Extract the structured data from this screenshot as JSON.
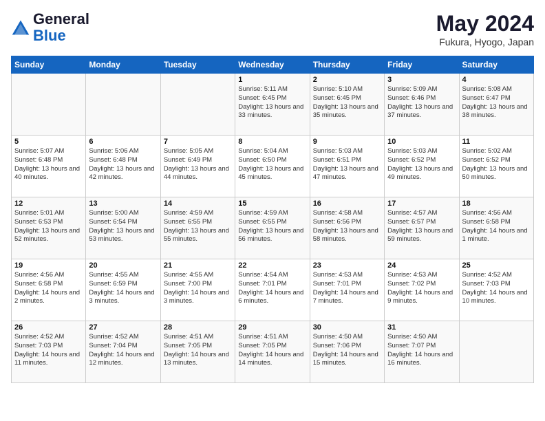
{
  "header": {
    "logo_general": "General",
    "logo_blue": "Blue",
    "month_title": "May 2024",
    "location": "Fukura, Hyogo, Japan"
  },
  "days_of_week": [
    "Sunday",
    "Monday",
    "Tuesday",
    "Wednesday",
    "Thursday",
    "Friday",
    "Saturday"
  ],
  "weeks": [
    [
      {
        "day": "",
        "content": ""
      },
      {
        "day": "",
        "content": ""
      },
      {
        "day": "",
        "content": ""
      },
      {
        "day": "1",
        "content": "Sunrise: 5:11 AM\nSunset: 6:45 PM\nDaylight: 13 hours and 33 minutes."
      },
      {
        "day": "2",
        "content": "Sunrise: 5:10 AM\nSunset: 6:45 PM\nDaylight: 13 hours and 35 minutes."
      },
      {
        "day": "3",
        "content": "Sunrise: 5:09 AM\nSunset: 6:46 PM\nDaylight: 13 hours and 37 minutes."
      },
      {
        "day": "4",
        "content": "Sunrise: 5:08 AM\nSunset: 6:47 PM\nDaylight: 13 hours and 38 minutes."
      }
    ],
    [
      {
        "day": "5",
        "content": "Sunrise: 5:07 AM\nSunset: 6:48 PM\nDaylight: 13 hours and 40 minutes."
      },
      {
        "day": "6",
        "content": "Sunrise: 5:06 AM\nSunset: 6:48 PM\nDaylight: 13 hours and 42 minutes."
      },
      {
        "day": "7",
        "content": "Sunrise: 5:05 AM\nSunset: 6:49 PM\nDaylight: 13 hours and 44 minutes."
      },
      {
        "day": "8",
        "content": "Sunrise: 5:04 AM\nSunset: 6:50 PM\nDaylight: 13 hours and 45 minutes."
      },
      {
        "day": "9",
        "content": "Sunrise: 5:03 AM\nSunset: 6:51 PM\nDaylight: 13 hours and 47 minutes."
      },
      {
        "day": "10",
        "content": "Sunrise: 5:03 AM\nSunset: 6:52 PM\nDaylight: 13 hours and 49 minutes."
      },
      {
        "day": "11",
        "content": "Sunrise: 5:02 AM\nSunset: 6:52 PM\nDaylight: 13 hours and 50 minutes."
      }
    ],
    [
      {
        "day": "12",
        "content": "Sunrise: 5:01 AM\nSunset: 6:53 PM\nDaylight: 13 hours and 52 minutes."
      },
      {
        "day": "13",
        "content": "Sunrise: 5:00 AM\nSunset: 6:54 PM\nDaylight: 13 hours and 53 minutes."
      },
      {
        "day": "14",
        "content": "Sunrise: 4:59 AM\nSunset: 6:55 PM\nDaylight: 13 hours and 55 minutes."
      },
      {
        "day": "15",
        "content": "Sunrise: 4:59 AM\nSunset: 6:55 PM\nDaylight: 13 hours and 56 minutes."
      },
      {
        "day": "16",
        "content": "Sunrise: 4:58 AM\nSunset: 6:56 PM\nDaylight: 13 hours and 58 minutes."
      },
      {
        "day": "17",
        "content": "Sunrise: 4:57 AM\nSunset: 6:57 PM\nDaylight: 13 hours and 59 minutes."
      },
      {
        "day": "18",
        "content": "Sunrise: 4:56 AM\nSunset: 6:58 PM\nDaylight: 14 hours and 1 minute."
      }
    ],
    [
      {
        "day": "19",
        "content": "Sunrise: 4:56 AM\nSunset: 6:58 PM\nDaylight: 14 hours and 2 minutes."
      },
      {
        "day": "20",
        "content": "Sunrise: 4:55 AM\nSunset: 6:59 PM\nDaylight: 14 hours and 3 minutes."
      },
      {
        "day": "21",
        "content": "Sunrise: 4:55 AM\nSunset: 7:00 PM\nDaylight: 14 hours and 3 minutes."
      },
      {
        "day": "22",
        "content": "Sunrise: 4:54 AM\nSunset: 7:01 PM\nDaylight: 14 hours and 6 minutes."
      },
      {
        "day": "23",
        "content": "Sunrise: 4:53 AM\nSunset: 7:01 PM\nDaylight: 14 hours and 7 minutes."
      },
      {
        "day": "24",
        "content": "Sunrise: 4:53 AM\nSunset: 7:02 PM\nDaylight: 14 hours and 9 minutes."
      },
      {
        "day": "25",
        "content": "Sunrise: 4:52 AM\nSunset: 7:03 PM\nDaylight: 14 hours and 10 minutes."
      }
    ],
    [
      {
        "day": "26",
        "content": "Sunrise: 4:52 AM\nSunset: 7:03 PM\nDaylight: 14 hours and 11 minutes."
      },
      {
        "day": "27",
        "content": "Sunrise: 4:52 AM\nSunset: 7:04 PM\nDaylight: 14 hours and 12 minutes."
      },
      {
        "day": "28",
        "content": "Sunrise: 4:51 AM\nSunset: 7:05 PM\nDaylight: 14 hours and 13 minutes."
      },
      {
        "day": "29",
        "content": "Sunrise: 4:51 AM\nSunset: 7:05 PM\nDaylight: 14 hours and 14 minutes."
      },
      {
        "day": "30",
        "content": "Sunrise: 4:50 AM\nSunset: 7:06 PM\nDaylight: 14 hours and 15 minutes."
      },
      {
        "day": "31",
        "content": "Sunrise: 4:50 AM\nSunset: 7:07 PM\nDaylight: 14 hours and 16 minutes."
      },
      {
        "day": "",
        "content": ""
      }
    ]
  ]
}
